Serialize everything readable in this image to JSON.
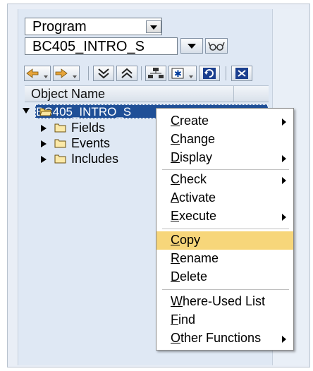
{
  "object_type": {
    "value": "Program"
  },
  "object_name": {
    "value": "BC405_INTRO_S"
  },
  "toolbar": {
    "buttons": [
      {
        "name": "back-button",
        "icon": "arrow-left-icon"
      },
      {
        "name": "forward-button",
        "icon": "arrow-right-icon"
      },
      {
        "name": "collapse-button",
        "icon": "double-chevron-down-icon"
      },
      {
        "name": "expand-button",
        "icon": "double-chevron-up-icon"
      },
      {
        "name": "hierarchy-button",
        "icon": "hierarchy-icon"
      },
      {
        "name": "display-object-button",
        "icon": "star-icon"
      },
      {
        "name": "refresh-button",
        "icon": "refresh-icon"
      },
      {
        "name": "close-button",
        "icon": "close-icon"
      }
    ]
  },
  "column_header": "Object Name",
  "tree": {
    "root": "BC405_INTRO_S",
    "children": [
      "Fields",
      "Events",
      "Includes"
    ]
  },
  "context_menu": {
    "groups": [
      [
        {
          "first": "C",
          "rest": "reate",
          "submenu": true
        },
        {
          "first": "C",
          "rest": "hange",
          "submenu": false
        },
        {
          "first": "D",
          "rest": "isplay",
          "submenu": true
        }
      ],
      [
        {
          "first": "C",
          "rest": "heck",
          "submenu": true
        },
        {
          "first": "A",
          "rest": "ctivate",
          "submenu": false
        },
        {
          "first": "E",
          "rest": "xecute",
          "submenu": true
        }
      ],
      [
        {
          "first": "C",
          "rest": "opy",
          "submenu": false,
          "highlighted": true
        },
        {
          "first": "R",
          "rest": "ename",
          "submenu": false
        },
        {
          "first": "D",
          "rest": "elete",
          "submenu": false
        }
      ],
      [
        {
          "first": "W",
          "rest": "here-Used List",
          "submenu": false
        },
        {
          "first": "F",
          "rest": "ind",
          "submenu": false
        },
        {
          "first": "O",
          "rest": "ther Functions",
          "submenu": true
        }
      ]
    ]
  },
  "colors": {
    "selection": "#1f4f97",
    "menu_highlight": "#f7d67a",
    "pane_bg": "#dfe8f4"
  }
}
